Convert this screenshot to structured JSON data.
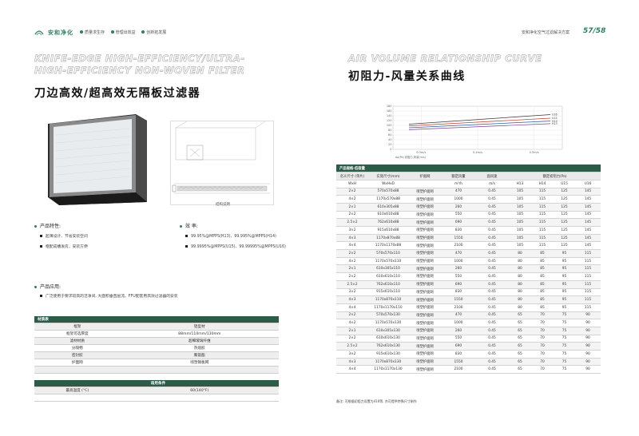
{
  "header": {
    "brand": "安和净化",
    "tags": [
      "质量求生存",
      "管理出效益",
      "创新拓发展"
    ],
    "solution": "安和净化空气过滤解决方案",
    "page": "57/58"
  },
  "left": {
    "en_title": "KNIFE-EDGE HIGH-EFFICIENCY/ULTRA-HIGH-EFFICIENCY NON-WOVEN FILTER",
    "cn_title": "刀边高效/超高效无隔板过滤器",
    "structure_caption": "结构说明",
    "features_title": "产品特性:",
    "features": [
      "超薄设计、节省安装空间",
      "框配成槽发房，安装方便"
    ],
    "efficiency_title": "效 率:",
    "efficiency": [
      "99.95%@MPPS(H13)、99.995%@MPPS(H14)",
      "99.9995%@MPPS(U15)、99.99995%@MPPS(U16)"
    ],
    "application_title": "产品应用:",
    "applications": [
      "广泛使用于要求较高的洁净间, 大面积垂直层流、FFU配套用高效过滤器的安装"
    ],
    "materials": {
      "header": "材质表",
      "rows": [
        [
          "框架",
          "铝型材"
        ],
        [
          "框架可选厚度",
          "88mm/110mm/130mm"
        ],
        [
          "滤材材质",
          "超细玻璃纤维"
        ],
        [
          "分隔物",
          "热熔胶"
        ],
        [
          "密封胶",
          "聚氨酯"
        ],
        [
          "护面网",
          "喷塑钢板网"
        ],
        [
          "",
          ""
        ]
      ],
      "cond_header": "适用条件",
      "cond_rows": [
        [
          "最高温度 (°C)",
          "60(140°F)"
        ],
        [
          "",
          ""
        ]
      ]
    }
  },
  "right": {
    "en_title": "AIR VOLUME RELATIONSHIP CURVE",
    "cn_title": "初阻力-风量关系曲线"
  },
  "chart_data": {
    "type": "line",
    "ylim": [
      0,
      180
    ],
    "yticks": [
      "180",
      "160",
      "140",
      "120",
      "100",
      "80",
      "60",
      "40",
      "20",
      "0"
    ],
    "xticks": [
      "0.3m/s",
      "0.4m/s",
      "0.5m/s"
    ],
    "xlabel_note": "Δp(Pa) 初阻力 风量(m/s)",
    "x": [
      0.2,
      0.6
    ],
    "series": [
      {
        "name": "U16",
        "color": "#3a3a3a",
        "values": [
          105,
          145
        ]
      },
      {
        "name": "U15",
        "color": "#c0392b",
        "values": [
          98,
          130
        ]
      },
      {
        "name": "H14",
        "color": "#2c5aa0",
        "values": [
          90,
          118
        ]
      },
      {
        "name": "H13",
        "color": "#7d3c98",
        "values": [
          82,
          107
        ]
      }
    ]
  },
  "table": {
    "title": "产品规格-低容量",
    "head1": [
      "名义尺寸 (单片)",
      "实际尺寸(mm)",
      "护面网",
      "额定风量",
      "面风速",
      "额定初阻力(Pa)"
    ],
    "head2": [
      "WxH",
      "WxHxD",
      "",
      "m³/h",
      "m/s",
      "H13",
      "H14",
      "U15",
      "U16"
    ],
    "rows": [
      [
        "2×2",
        "570x570x88",
        "喷塑护面网",
        "470",
        "0.45",
        "105",
        "115",
        "125",
        "145"
      ],
      [
        "4×2",
        "1170x570x88",
        "喷塑护面网",
        "1000",
        "0.45",
        "105",
        "115",
        "125",
        "145"
      ],
      [
        "2×1",
        "610x305x88",
        "喷塑护面网",
        "260",
        "0.45",
        "105",
        "115",
        "125",
        "145"
      ],
      [
        "2×2",
        "610x610x88",
        "喷塑护面网",
        "550",
        "0.45",
        "105",
        "115",
        "125",
        "145"
      ],
      [
        "2.5×2",
        "762x610x88",
        "喷塑护面网",
        "690",
        "0.45",
        "105",
        "115",
        "125",
        "145"
      ],
      [
        "3×2",
        "915x610x88",
        "喷塑护面网",
        "830",
        "0.45",
        "105",
        "115",
        "125",
        "145"
      ],
      [
        "4×3",
        "1170x870x88",
        "喷塑护面网",
        "1550",
        "0.45",
        "105",
        "115",
        "125",
        "145"
      ],
      [
        "4×4",
        "1170x1170x88",
        "喷塑护面网",
        "2100",
        "0.45",
        "105",
        "115",
        "125",
        "145"
      ],
      [
        "2×2",
        "570x570x110",
        "喷塑护面网",
        "470",
        "0.45",
        "80",
        "85",
        "95",
        "115"
      ],
      [
        "4×2",
        "1170x570x110",
        "喷塑护面网",
        "1000",
        "0.45",
        "80",
        "85",
        "95",
        "115"
      ],
      [
        "2×1",
        "610x305x110",
        "喷塑护面网",
        "260",
        "0.45",
        "80",
        "85",
        "95",
        "115"
      ],
      [
        "2×2",
        "610x610x110",
        "喷塑护面网",
        "550",
        "0.45",
        "80",
        "85",
        "95",
        "115"
      ],
      [
        "2.5×2",
        "762x610x110",
        "喷塑护面网",
        "690",
        "0.45",
        "80",
        "85",
        "95",
        "115"
      ],
      [
        "3×2",
        "915x610x110",
        "喷塑护面网",
        "830",
        "0.45",
        "80",
        "85",
        "95",
        "115"
      ],
      [
        "4×3",
        "1170x870x110",
        "喷塑护面网",
        "1550",
        "0.45",
        "80",
        "85",
        "95",
        "115"
      ],
      [
        "4×4",
        "1170x1170x110",
        "喷塑护面网",
        "2100",
        "0.45",
        "80",
        "85",
        "95",
        "115"
      ],
      [
        "2×2",
        "570x570x130",
        "喷塑护面网",
        "470",
        "0.45",
        "65",
        "70",
        "75",
        "90"
      ],
      [
        "4×2",
        "1170x570x130",
        "喷塑护面网",
        "1000",
        "0.45",
        "65",
        "70",
        "75",
        "90"
      ],
      [
        "2×1",
        "610x305x130",
        "喷塑护面网",
        "260",
        "0.45",
        "65",
        "70",
        "75",
        "90"
      ],
      [
        "2×2",
        "610x610x130",
        "喷塑护面网",
        "550",
        "0.45",
        "65",
        "70",
        "75",
        "90"
      ],
      [
        "2.5×2",
        "762x610x130",
        "喷塑护面网",
        "690",
        "0.45",
        "65",
        "70",
        "75",
        "90"
      ],
      [
        "3×2",
        "915x610x130",
        "喷塑护面网",
        "830",
        "0.45",
        "65",
        "70",
        "75",
        "90"
      ],
      [
        "4×3",
        "1170x870x130",
        "喷塑护面网",
        "1550",
        "0.45",
        "65",
        "70",
        "75",
        "90"
      ],
      [
        "4×4",
        "1170x1170x130",
        "喷塑护面网",
        "2100",
        "0.45",
        "65",
        "70",
        "75",
        "90"
      ]
    ],
    "note": "备注: 可根据初阻力设置为410等, 亦可提供特殊尺寸制作"
  }
}
